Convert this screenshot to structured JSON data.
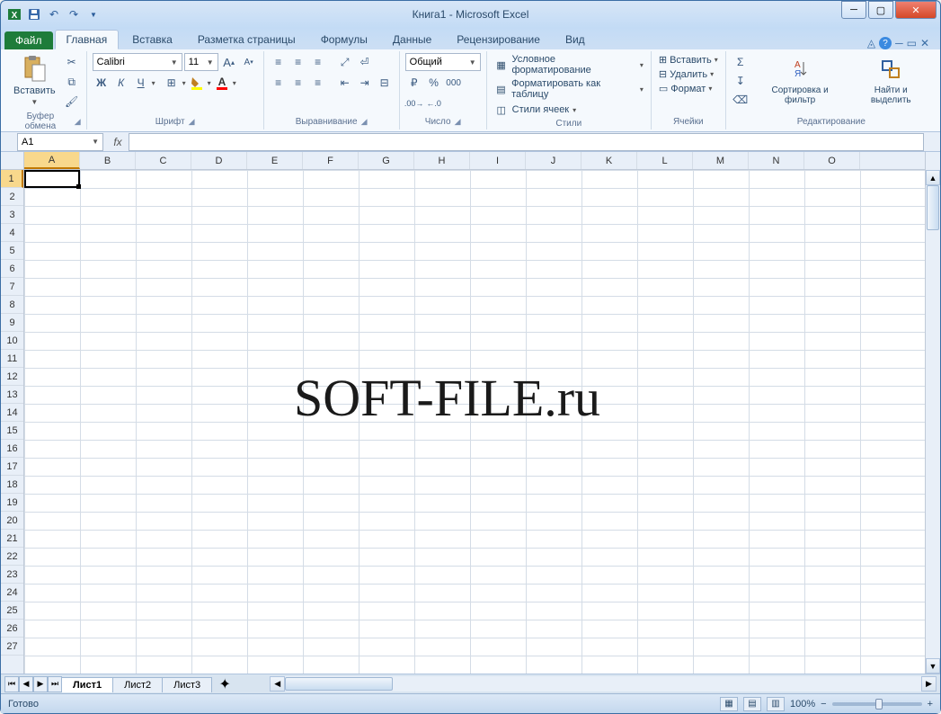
{
  "title": "Книга1 - Microsoft Excel",
  "file_tab": "Файл",
  "tabs": [
    "Главная",
    "Вставка",
    "Разметка страницы",
    "Формулы",
    "Данные",
    "Рецензирование",
    "Вид"
  ],
  "active_tab": 0,
  "groups": {
    "clipboard": {
      "label": "Буфер обмена",
      "paste": "Вставить"
    },
    "font": {
      "label": "Шрифт",
      "font_name": "Calibri",
      "font_size": "11"
    },
    "alignment": {
      "label": "Выравнивание"
    },
    "number": {
      "label": "Число",
      "format": "Общий"
    },
    "styles": {
      "label": "Стили",
      "cond": "Условное форматирование",
      "table": "Форматировать как таблицу",
      "cell": "Стили ячеек"
    },
    "cells": {
      "label": "Ячейки",
      "insert": "Вставить",
      "delete": "Удалить",
      "format": "Формат"
    },
    "editing": {
      "label": "Редактирование",
      "sort": "Сортировка и фильтр",
      "find": "Найти и выделить"
    }
  },
  "name_box": "A1",
  "columns": [
    "A",
    "B",
    "C",
    "D",
    "E",
    "F",
    "G",
    "H",
    "I",
    "J",
    "K",
    "L",
    "M",
    "N",
    "O"
  ],
  "row_count": 27,
  "selected_cell": "A1",
  "watermark": "SOFT-FILE.ru",
  "sheets": [
    "Лист1",
    "Лист2",
    "Лист3"
  ],
  "active_sheet": 0,
  "status_text": "Готово",
  "zoom": "100%"
}
